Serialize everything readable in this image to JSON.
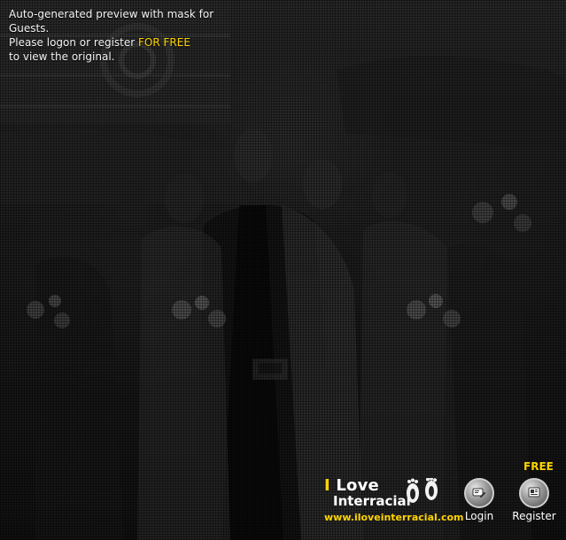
{
  "notice": {
    "line1": "Auto-generated preview with mask for Guests.",
    "line2_prefix": "Please logon or register ",
    "line2_free": "FOR FREE",
    "line3": "to view the original."
  },
  "branding": {
    "logo_line1_i": "I",
    "logo_line1_rest": " Love",
    "logo_line2": "Interracial",
    "site_url": "www.iloveinterracial.com"
  },
  "actions": {
    "free_label": "FREE",
    "login_label": "Login",
    "register_label": "Register"
  },
  "colors": {
    "accent_yellow": "#ffd400",
    "text_white": "#ffffff"
  },
  "icons": {
    "login": "login-icon",
    "register": "register-icon",
    "footprints": "footprints-icon"
  }
}
